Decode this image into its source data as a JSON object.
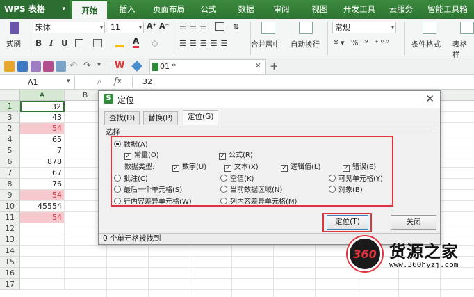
{
  "titlebar": {
    "app_name": "WPS 表格",
    "tabs": [
      "开始",
      "插入",
      "页面布局",
      "公式",
      "数据",
      "审阅",
      "视图",
      "开发工具",
      "云服务",
      "智能工具箱"
    ]
  },
  "ribbon": {
    "format_painter": "式刷",
    "font_name": "宋体",
    "font_size": "11",
    "merge_center": "合并居中",
    "wrap_text": "自动换行",
    "number_format": "常规",
    "cond_format": "条件格式",
    "table_style": "表格样"
  },
  "doc_tab": {
    "name": "01 *"
  },
  "formula_bar": {
    "name_box": "A1",
    "fx": "fx",
    "value": "32"
  },
  "grid": {
    "columns": [
      "A",
      "B"
    ],
    "rows": [
      {
        "num": "1",
        "a": "32",
        "highlight": false
      },
      {
        "num": "3",
        "a": "43",
        "highlight": false
      },
      {
        "num": "2",
        "a": "54",
        "highlight": true
      },
      {
        "num": "4",
        "a": "65",
        "highlight": false
      },
      {
        "num": "5",
        "a": "7",
        "highlight": false
      },
      {
        "num": "6",
        "a": "878",
        "highlight": false
      },
      {
        "num": "7",
        "a": "67",
        "highlight": false
      },
      {
        "num": "8",
        "a": "76",
        "highlight": false
      },
      {
        "num": "9",
        "a": "54",
        "highlight": true
      },
      {
        "num": "10",
        "a": "45554",
        "highlight": false
      },
      {
        "num": "11",
        "a": "54",
        "highlight": true
      },
      {
        "num": "12",
        "a": "",
        "highlight": false
      },
      {
        "num": "13",
        "a": "",
        "highlight": false
      },
      {
        "num": "14",
        "a": "",
        "highlight": false
      },
      {
        "num": "15",
        "a": "",
        "highlight": false
      },
      {
        "num": "16",
        "a": "",
        "highlight": false
      },
      {
        "num": "17",
        "a": "",
        "highlight": false
      }
    ]
  },
  "dialog": {
    "title": "定位",
    "tabs": [
      "查找(D)",
      "替换(P)",
      "定位(G)"
    ],
    "group_label": "选择",
    "data_option": "数据(A)",
    "constant": "常量(O)",
    "formula": "公式(R)",
    "data_type_label": "数据类型:",
    "number": "数字(U)",
    "text": "文本(X)",
    "logical": "逻辑值(L)",
    "error": "错误(E)",
    "comments": "批注(C)",
    "blanks": "空值(K)",
    "visible_cells": "可见单元格(Y)",
    "last_cell": "最后一个单元格(S)",
    "current_region": "当前数据区域(N)",
    "objects": "对象(B)",
    "row_diff": "行内容差异单元格(W)",
    "col_diff": "列内容差异单元格(M)",
    "ok_button": "定位(T)",
    "close_button": "关闭",
    "status": "0 个单元格被找到"
  },
  "watermark": {
    "logo": "360",
    "text": "货源之家",
    "url": "www.360hyzj.com"
  }
}
